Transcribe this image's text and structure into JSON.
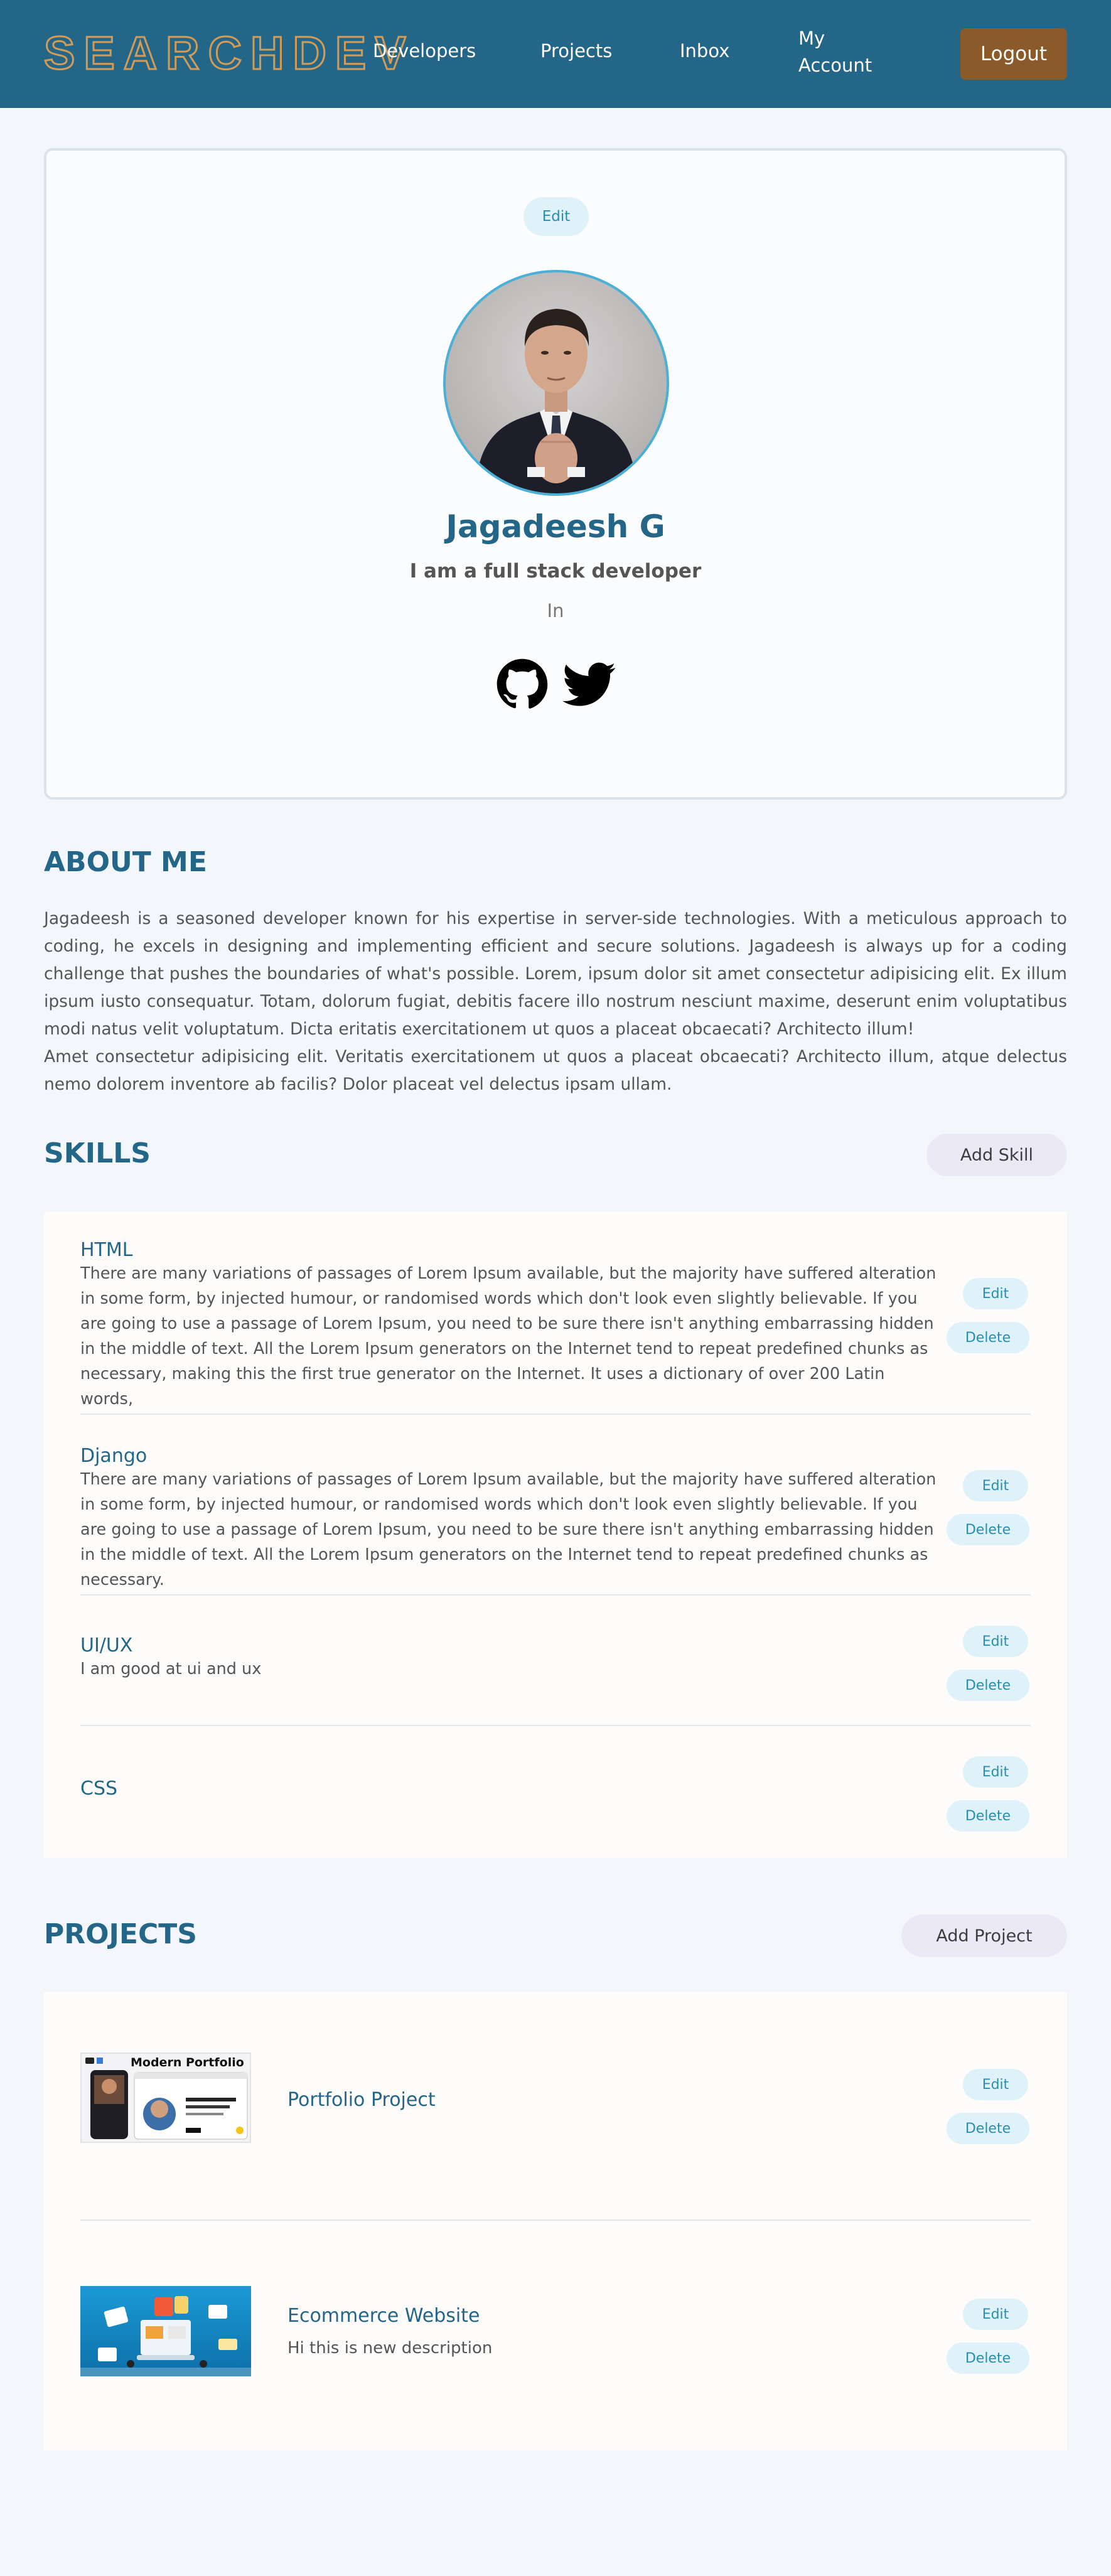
{
  "header": {
    "logo": "SEARCHDEV",
    "nav": {
      "developers": "Developers",
      "projects": "Projects",
      "inbox": "Inbox",
      "account": "My Account"
    },
    "logout_label": "Logout"
  },
  "profile": {
    "edit_label": "Edit",
    "name": "Jagadeesh G",
    "headline": "I am a full stack developer",
    "location": "In",
    "socials": [
      "github-icon",
      "twitter-icon"
    ]
  },
  "about": {
    "title": "ABOUT ME",
    "paragraph1": "Jagadeesh is a seasoned developer known for his expertise in server-side technologies. With a meticulous approach to coding, he excels in designing and implementing efficient and secure solutions. Jagadeesh is always up for a coding challenge that pushes the boundaries of what's possible. Lorem, ipsum dolor sit amet consectetur adipisicing elit. Ex illum ipsum iusto consequatur. Totam, dolorum fugiat, debitis facere illo nostrum nesciunt maxime, deserunt enim voluptatibus modi natus velit voluptatum. Dicta eritatis exercitationem ut quos a placeat obcaecati? Architecto illum!",
    "paragraph2": "Amet consectetur adipisicing elit. Veritatis exercitationem ut quos a placeat obcaecati? Architecto illum, atque delectus nemo dolorem inventore ab facilis? Dolor placeat vel delectus ipsam ullam."
  },
  "skills": {
    "title": "SKILLS",
    "add_label": "Add Skill",
    "edit_label": "Edit",
    "delete_label": "Delete",
    "items": [
      {
        "name": "HTML",
        "description": "There are many variations of passages of Lorem Ipsum available, but the majority have suffered alteration in some form, by injected humour, or randomised words which don't look even slightly believable. If you are going to use a passage of Lorem Ipsum, you need to be sure there isn't anything embarrassing hidden in the middle of text. All the Lorem Ipsum generators on the Internet tend to repeat predefined chunks as necessary, making this the first true generator on the Internet. It uses a dictionary of over 200 Latin words,"
      },
      {
        "name": "Django",
        "description": "There are many variations of passages of Lorem Ipsum available, but the majority have suffered alteration in some form, by injected humour, or randomised words which don't look even slightly believable. If you are going to use a passage of Lorem Ipsum, you need to be sure there isn't anything embarrassing hidden in the middle of text. All the Lorem Ipsum generators on the Internet tend to repeat predefined chunks as necessary."
      },
      {
        "name": "UI/UX",
        "description": "I am good at ui and ux"
      },
      {
        "name": "CSS",
        "description": ""
      }
    ]
  },
  "projects": {
    "title": "PROJECTS",
    "add_label": "Add Project",
    "edit_label": "Edit",
    "delete_label": "Delete",
    "items": [
      {
        "title": "Portfolio Project",
        "description": "",
        "thumb_heading": "Modern Portfolio"
      },
      {
        "title": "Ecommerce Website",
        "description": "Hi this is new description"
      }
    ]
  },
  "colors": {
    "header_bg": "#246687",
    "logo_outline": "#d39b55",
    "logout_bg": "#8a5a2a",
    "accent": "#246687",
    "pill_bg": "#dff2fa",
    "add_pill_bg": "#ece9f7"
  }
}
